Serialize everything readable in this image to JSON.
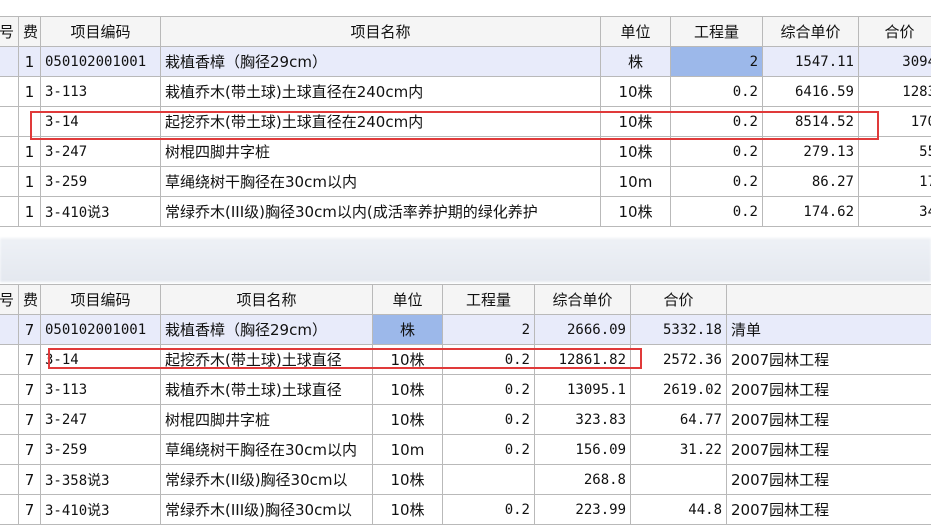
{
  "top": {
    "headers": [
      "号",
      "费",
      "项目编码",
      "项目名称",
      "单位",
      "工程量",
      "综合单价",
      "合价"
    ],
    "rows": [
      [
        "",
        "1",
        "050102001001",
        "栽植香樟（胸径29cm）",
        "株",
        "2",
        "1547.11",
        "3094"
      ],
      [
        "",
        "1",
        "3-113",
        "栽植乔木(带土球)土球直径在240cm内",
        "10株",
        "0.2",
        "6416.59",
        "1283"
      ],
      [
        "",
        "",
        "3-14",
        "起挖乔木(带土球)土球直径在240cm内",
        "10株",
        "0.2",
        "8514.52",
        "170"
      ],
      [
        "",
        "1",
        "3-247",
        "树棍四脚井字桩",
        "10株",
        "0.2",
        "279.13",
        "55"
      ],
      [
        "",
        "1",
        "3-259",
        "草绳绕树干胸径在30cm以内",
        "10m",
        "0.2",
        "86.27",
        "17"
      ],
      [
        "",
        "1",
        "3-410说3",
        "常绿乔木(III级)胸径30cm以内(成活率养护期的绿化养护",
        "10株",
        "0.2",
        "174.62",
        "34"
      ]
    ]
  },
  "bottom": {
    "headers": [
      "号",
      "费",
      "项目编码",
      "项目名称",
      "单位",
      "工程量",
      "综合单价",
      "合价",
      ""
    ],
    "rows": [
      [
        "",
        "7",
        "050102001001",
        "栽植香樟（胸径29cm）",
        "株",
        "2",
        "2666.09",
        "5332.18",
        "清单"
      ],
      [
        "",
        "7",
        "3-14",
        "起挖乔木(带土球)土球直径",
        "10株",
        "0.2",
        "12861.82",
        "2572.36",
        "2007园林工程"
      ],
      [
        "",
        "7",
        "3-113",
        "栽植乔木(带土球)土球直径",
        "10株",
        "0.2",
        "13095.1",
        "2619.02",
        "2007园林工程"
      ],
      [
        "",
        "7",
        "3-247",
        "树棍四脚井字桩",
        "10株",
        "0.2",
        "323.83",
        "64.77",
        "2007园林工程"
      ],
      [
        "",
        "7",
        "3-259",
        "草绳绕树干胸径在30cm以内",
        "10m",
        "0.2",
        "156.09",
        "31.22",
        "2007园林工程"
      ],
      [
        "",
        "7",
        "3-358说3",
        "常绿乔木(II级)胸径30cm以",
        "10株",
        "",
        "268.8",
        "",
        "2007园林工程"
      ],
      [
        "",
        "7",
        "3-410说3",
        "常绿乔木(III级)胸径30cm以",
        "10株",
        "0.2",
        "223.99",
        "44.8",
        "2007园林工程"
      ]
    ]
  },
  "colors": {
    "header_bg": "#f5f5f5",
    "selected_row": "#e8ebfa",
    "highlight_cell": "#9cb8ea",
    "annotation_red": "#e03a3a"
  }
}
